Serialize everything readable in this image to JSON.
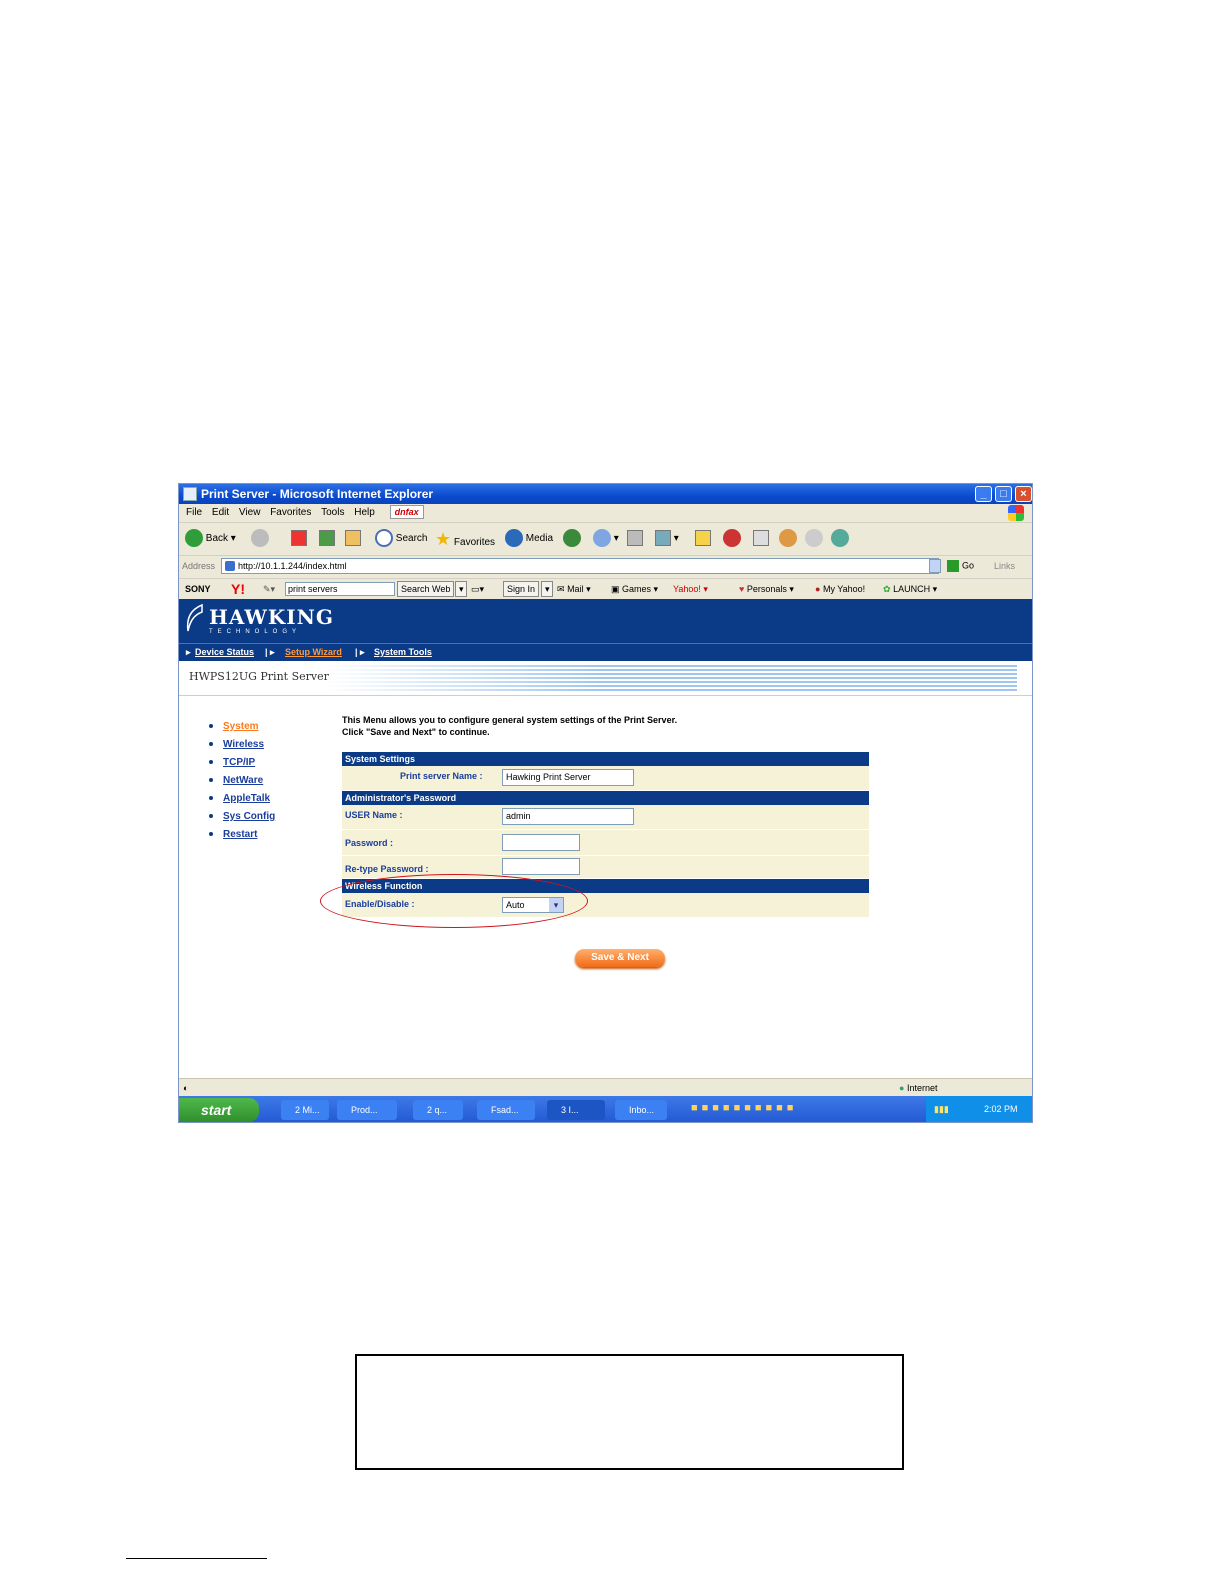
{
  "window": {
    "title": "Print Server - Microsoft Internet Explorer",
    "controls": [
      "_",
      "□",
      "×"
    ]
  },
  "menubar": {
    "items": [
      "File",
      "Edit",
      "View",
      "Favorites",
      "Tools",
      "Help"
    ],
    "badge": "dnfax"
  },
  "toolbar": {
    "back": "Back",
    "search": "Search",
    "favorites": "Favorites",
    "media": "Media"
  },
  "address": {
    "label": "Address",
    "url": "http://10.1.1.244/index.html",
    "go": "Go",
    "links": "Links"
  },
  "yahoo_bar": {
    "sony": "SONY",
    "y": "Y!",
    "search_value": "print servers",
    "search_web": "Search Web",
    "sign_in": "Sign In",
    "mail": "Mail",
    "games": "Games",
    "yahoo": "Yahoo!",
    "personals": "Personals",
    "my_yahoo": "My Yahoo!",
    "launch": "LAUNCH"
  },
  "site": {
    "brand": "HAWKING",
    "brand_sub": "TECHNOLOGY",
    "nav": [
      "Device Status",
      "Setup Wizard",
      "System Tools"
    ],
    "device_name": "HWPS12UG Print Server"
  },
  "left_menu": [
    "System",
    "Wireless",
    "TCP/IP",
    "NetWare",
    "AppleTalk",
    "Sys Config",
    "Restart"
  ],
  "intro": {
    "line1": "This Menu allows you to configure general system settings of the Print Server.",
    "line2": "Click \"Save and Next\" to continue."
  },
  "form": {
    "system_settings": {
      "title": "System Settings",
      "server_name_label": "Print server Name :",
      "server_name_value": "Hawking Print Server"
    },
    "admin_password": {
      "title": "Administrator's Password",
      "user_label": "USER Name :",
      "user_value": "admin",
      "password_label": "Password :",
      "retype_label": "Re-type Password :"
    },
    "wireless": {
      "title": "Wireless Function",
      "enable_label": "Enable/Disable :",
      "enable_value": "Auto"
    },
    "save_button": "Save & Next"
  },
  "statusbar": {
    "zone": "Internet"
  },
  "taskbar": {
    "start": "start",
    "tasks": [
      "2 Mi...",
      "Prod...",
      "2 q...",
      "Fsad...",
      "3 I...",
      "Inbo..."
    ],
    "clock": "2:02 PM"
  },
  "colors": {
    "banner": "#0b3a86",
    "active_link": "#ff7a1a",
    "form_row": "#f5f2d8",
    "highlight_ellipse": "#d0141c"
  }
}
